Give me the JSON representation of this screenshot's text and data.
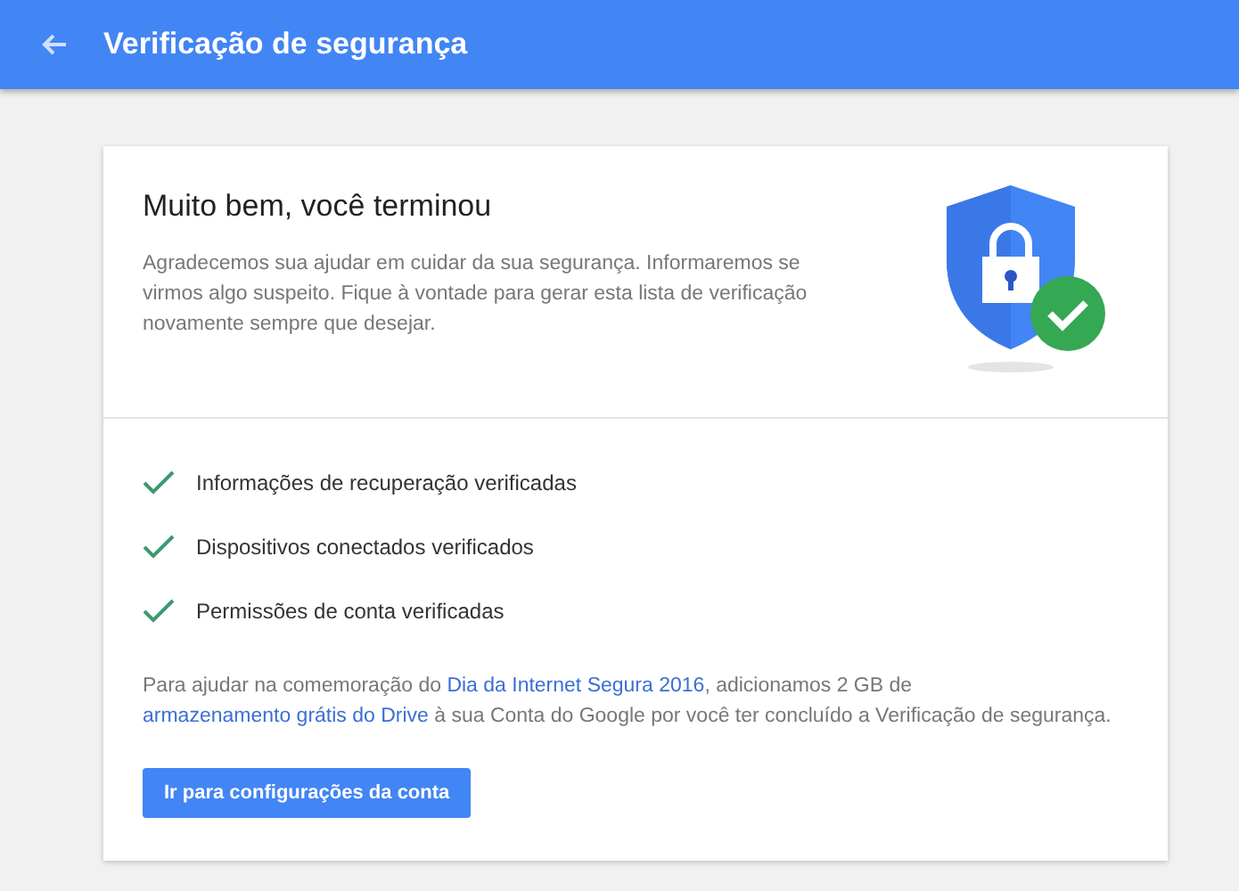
{
  "header": {
    "title": "Verificação de segurança"
  },
  "card": {
    "heading": "Muito bem, você terminou",
    "intro": "Agradecemos sua ajudar em cuidar da sua segurança. Informaremos se virmos algo suspeito. Fique à vontade para gerar esta lista de verificação novamente sempre que desejar.",
    "checks": [
      {
        "label": "Informações de recuperação verificadas",
        "checked": true
      },
      {
        "label": "Dispositivos conectados verificados",
        "checked": true
      },
      {
        "label": "Permissões de conta verificadas",
        "checked": true
      }
    ],
    "note": [
      {
        "kind": "text",
        "text": "Para ajudar na comemoração do "
      },
      {
        "kind": "link",
        "text": "Dia da Internet Segura 2016"
      },
      {
        "kind": "text",
        "text": ", adicionamos 2 GB de "
      },
      {
        "kind": "link",
        "text": "armazenamento grátis do Drive"
      },
      {
        "kind": "text",
        "text": " à sua Conta do Google por você ter concluído a Verificação de segurança."
      }
    ],
    "button": "Ir para configurações da conta"
  }
}
